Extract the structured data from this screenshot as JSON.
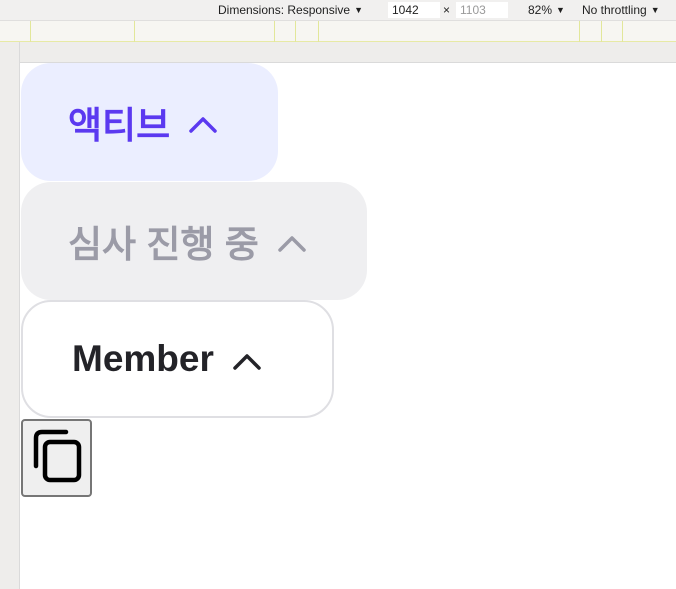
{
  "toolbar": {
    "dimensions_label": "Dimensions: Responsive",
    "width_value": "1042",
    "height_placeholder": "1103",
    "times_symbol": "×",
    "zoom_label": "82%",
    "throttling_label": "No throttling",
    "caret": "▼"
  },
  "chips": [
    {
      "label": "액티브",
      "state": "active",
      "icon": "chevron-up-icon",
      "color": "#5b39f0"
    },
    {
      "label": "심사 진행 중",
      "state": "disabled",
      "icon": "chevron-up-icon",
      "color": "#9b9ba7"
    },
    {
      "label": "Member",
      "state": "default",
      "icon": "chevron-up-icon",
      "color": "#232328"
    }
  ],
  "copy_button": {
    "icon": "copy-icon"
  }
}
